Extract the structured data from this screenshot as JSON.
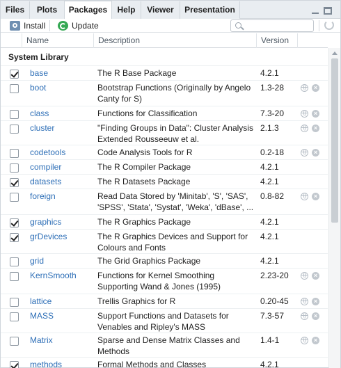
{
  "tabs": [
    {
      "label": "Files"
    },
    {
      "label": "Plots"
    },
    {
      "label": "Packages"
    },
    {
      "label": "Help"
    },
    {
      "label": "Viewer"
    },
    {
      "label": "Presentation"
    }
  ],
  "active_tab": "Packages",
  "toolbar": {
    "install_label": "Install",
    "update_label": "Update",
    "search_value": ""
  },
  "columns": {
    "name": "Name",
    "description": "Description",
    "version": "Version"
  },
  "section_title": "System Library",
  "packages": [
    {
      "name": "base",
      "description": "The R Base Package",
      "version": "4.2.1",
      "loaded": true,
      "actions": false
    },
    {
      "name": "boot",
      "description": "Bootstrap Functions (Originally by Angelo Canty for S)",
      "version": "1.3-28",
      "loaded": false,
      "actions": true
    },
    {
      "name": "class",
      "description": "Functions for Classification",
      "version": "7.3-20",
      "loaded": false,
      "actions": true
    },
    {
      "name": "cluster",
      "description": "\"Finding Groups in Data\": Cluster Analysis Extended Rousseeuw et al.",
      "version": "2.1.3",
      "loaded": false,
      "actions": true
    },
    {
      "name": "codetools",
      "description": "Code Analysis Tools for R",
      "version": "0.2-18",
      "loaded": false,
      "actions": true
    },
    {
      "name": "compiler",
      "description": "The R Compiler Package",
      "version": "4.2.1",
      "loaded": false,
      "actions": false
    },
    {
      "name": "datasets",
      "description": "The R Datasets Package",
      "version": "4.2.1",
      "loaded": true,
      "actions": false
    },
    {
      "name": "foreign",
      "description": "Read Data Stored by 'Minitab', 'S', 'SAS', 'SPSS', 'Stata', 'Systat', 'Weka', 'dBase', ...",
      "version": "0.8-82",
      "loaded": false,
      "actions": true
    },
    {
      "name": "graphics",
      "description": "The R Graphics Package",
      "version": "4.2.1",
      "loaded": true,
      "actions": false
    },
    {
      "name": "grDevices",
      "description": "The R Graphics Devices and Support for Colours and Fonts",
      "version": "4.2.1",
      "loaded": true,
      "actions": false
    },
    {
      "name": "grid",
      "description": "The Grid Graphics Package",
      "version": "4.2.1",
      "loaded": false,
      "actions": false
    },
    {
      "name": "KernSmooth",
      "description": "Functions for Kernel Smoothing Supporting Wand & Jones (1995)",
      "version": "2.23-20",
      "loaded": false,
      "actions": true
    },
    {
      "name": "lattice",
      "description": "Trellis Graphics for R",
      "version": "0.20-45",
      "loaded": false,
      "actions": true
    },
    {
      "name": "MASS",
      "description": "Support Functions and Datasets for Venables and Ripley's MASS",
      "version": "7.3-57",
      "loaded": false,
      "actions": true
    },
    {
      "name": "Matrix",
      "description": "Sparse and Dense Matrix Classes and Methods",
      "version": "1.4-1",
      "loaded": false,
      "actions": true
    },
    {
      "name": "methods",
      "description": "Formal Methods and Classes",
      "version": "4.2.1",
      "loaded": true,
      "actions": false
    }
  ]
}
